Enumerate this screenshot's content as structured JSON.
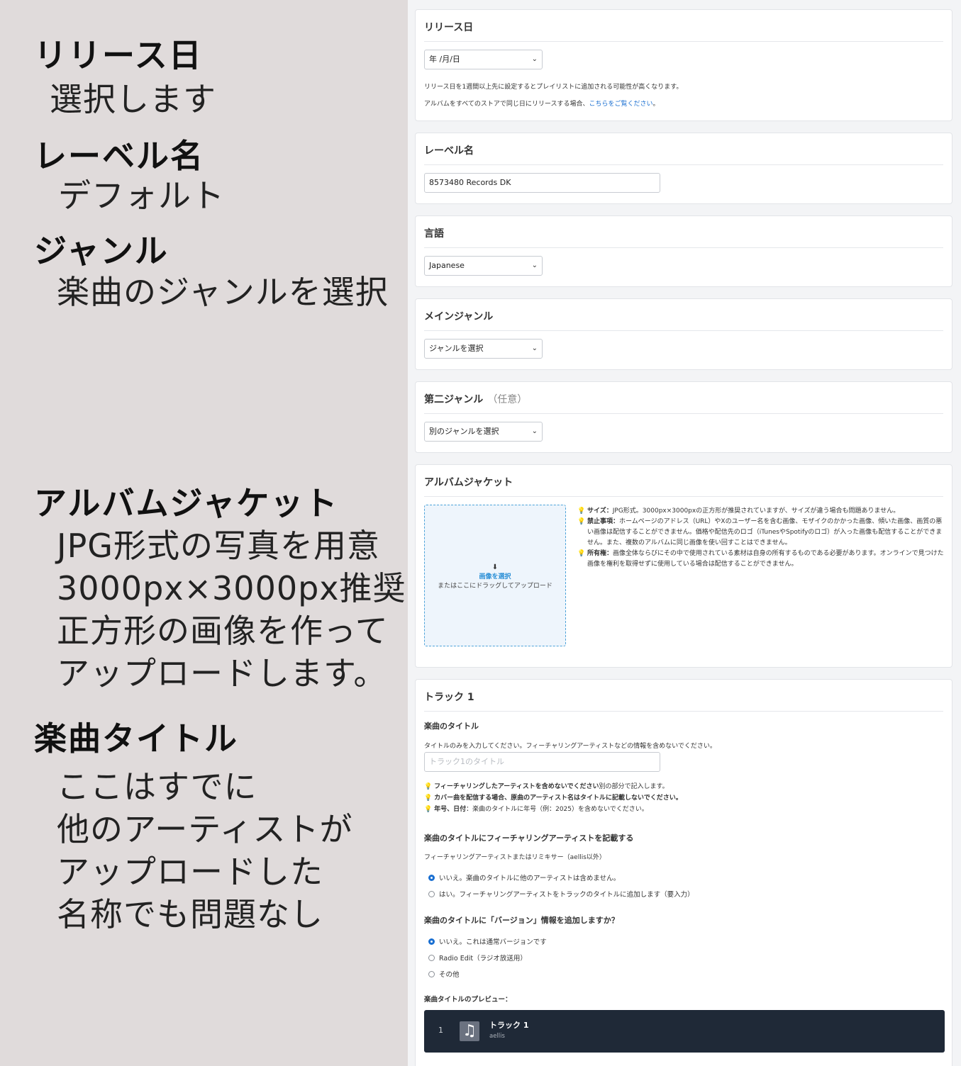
{
  "annotations": {
    "release": {
      "heading": "リリース日",
      "lines": [
        "選択します"
      ]
    },
    "label": {
      "heading": "レーベル名",
      "lines": [
        "デフォルト"
      ]
    },
    "genre": {
      "heading": "ジャンル",
      "lines": [
        "楽曲のジャンルを選択"
      ]
    },
    "jacket": {
      "heading": "アルバムジャケット",
      "lines": [
        "JPG形式の写真を用意",
        "3000px×3000px推奨",
        "正方形の画像を作って",
        "アップロードします。"
      ]
    },
    "song_title": {
      "heading": "楽曲タイトル",
      "lines": [
        "ここはすでに",
        "他のアーティストが",
        "アップロードした",
        "名称でも問題なし"
      ]
    }
  },
  "form": {
    "release_date": {
      "title": "リリース日",
      "value": "年 /月/日",
      "note1": "リリース日を1週間以上先に設定するとプレイリストに追加される可能性が高くなります。",
      "note2_prefix": "アルバムをすべてのストアで同じ日にリリースする場合、",
      "note2_link": "こちらをご覧ください",
      "note2_suffix": "。"
    },
    "label_name": {
      "title": "レーベル名",
      "value": "8573480 Records DK"
    },
    "language": {
      "title": "言語",
      "value": "Japanese"
    },
    "main_genre": {
      "title": "メインジャンル",
      "value": "ジャンルを選択"
    },
    "second_genre": {
      "title": "第二ジャンル",
      "optional": "（任意）",
      "value": "別のジャンルを選択"
    },
    "album_jacket": {
      "title": "アルバムジャケット",
      "upload_icon": "upload-icon",
      "upload_button": "画像を選択",
      "upload_hint": "またはここにドラッグしてアップロード",
      "guides": [
        {
          "bold": "サイズ：",
          "text": "JPG形式。3000px×3000pxの正方形が推奨されていますが、サイズが違う場合も問題ありません。"
        },
        {
          "bold": "禁止事項：",
          "text": "ホームページのアドレス（URL）やXのユーザー名を含む画像、モザイクのかかった画像、傾いた画像、画質の悪い画像は配信することができません。価格や配信先のロゴ（iTunesやSpotifyのロゴ）が入った画像も配信することができません。また、複数のアルバムに同じ画像を使い回すことはできません。"
        },
        {
          "bold": "所有権：",
          "text": "画像全体ならびにその中で使用されている素材は自身の所有するものである必要があります。オンラインで見つけた画像を権利を取得せずに使用している場合は配信することができません。"
        }
      ]
    },
    "track1": {
      "title": "トラック 1",
      "song_title_label": "楽曲のタイトル",
      "song_title_help": "タイトルのみを入力してください。フィーチャリングアーティストなどの情報を含めないでください。",
      "song_title_placeholder": "トラック1のタイトル",
      "tips": [
        {
          "bold": "フィーチャリングしたアーティストを含めないでください",
          "text": "別の部分で記入します。"
        },
        {
          "bold": "カバー曲を配信する場合、原曲のアーティスト名はタイトルに記載しないでください。",
          "text": ""
        },
        {
          "bold": "年号、日付",
          "text": "：楽曲のタイトルに年号（例：2025）を含めないでください。"
        }
      ],
      "feat_heading": "楽曲のタイトルにフィーチャリングアーティストを記載する",
      "feat_help": "フィーチャリングアーティストまたはリミキサー（aellis以外）",
      "feat_options": [
        "いいえ。楽曲のタイトルに他のアーティストは含めません。",
        "はい。フィーチャリングアーティストをトラックのタイトルに追加します（要入力）"
      ],
      "version_heading": "楽曲のタイトルに「バージョン」情報を追加しますか？",
      "version_options": [
        "いいえ。これは通常バージョンです",
        "Radio Edit（ラジオ放送用）",
        "その他"
      ],
      "preview_label": "楽曲タイトルのプレビュー：",
      "preview": {
        "number": "1",
        "title": "トラック 1",
        "artist": "aellis",
        "art_icon": "music-note-icon"
      }
    }
  },
  "colors": {
    "left_bg": "#e0dbdb",
    "link": "#1a6fd1",
    "preview_bg": "#1f2937",
    "upload_border": "#4da3d9"
  }
}
